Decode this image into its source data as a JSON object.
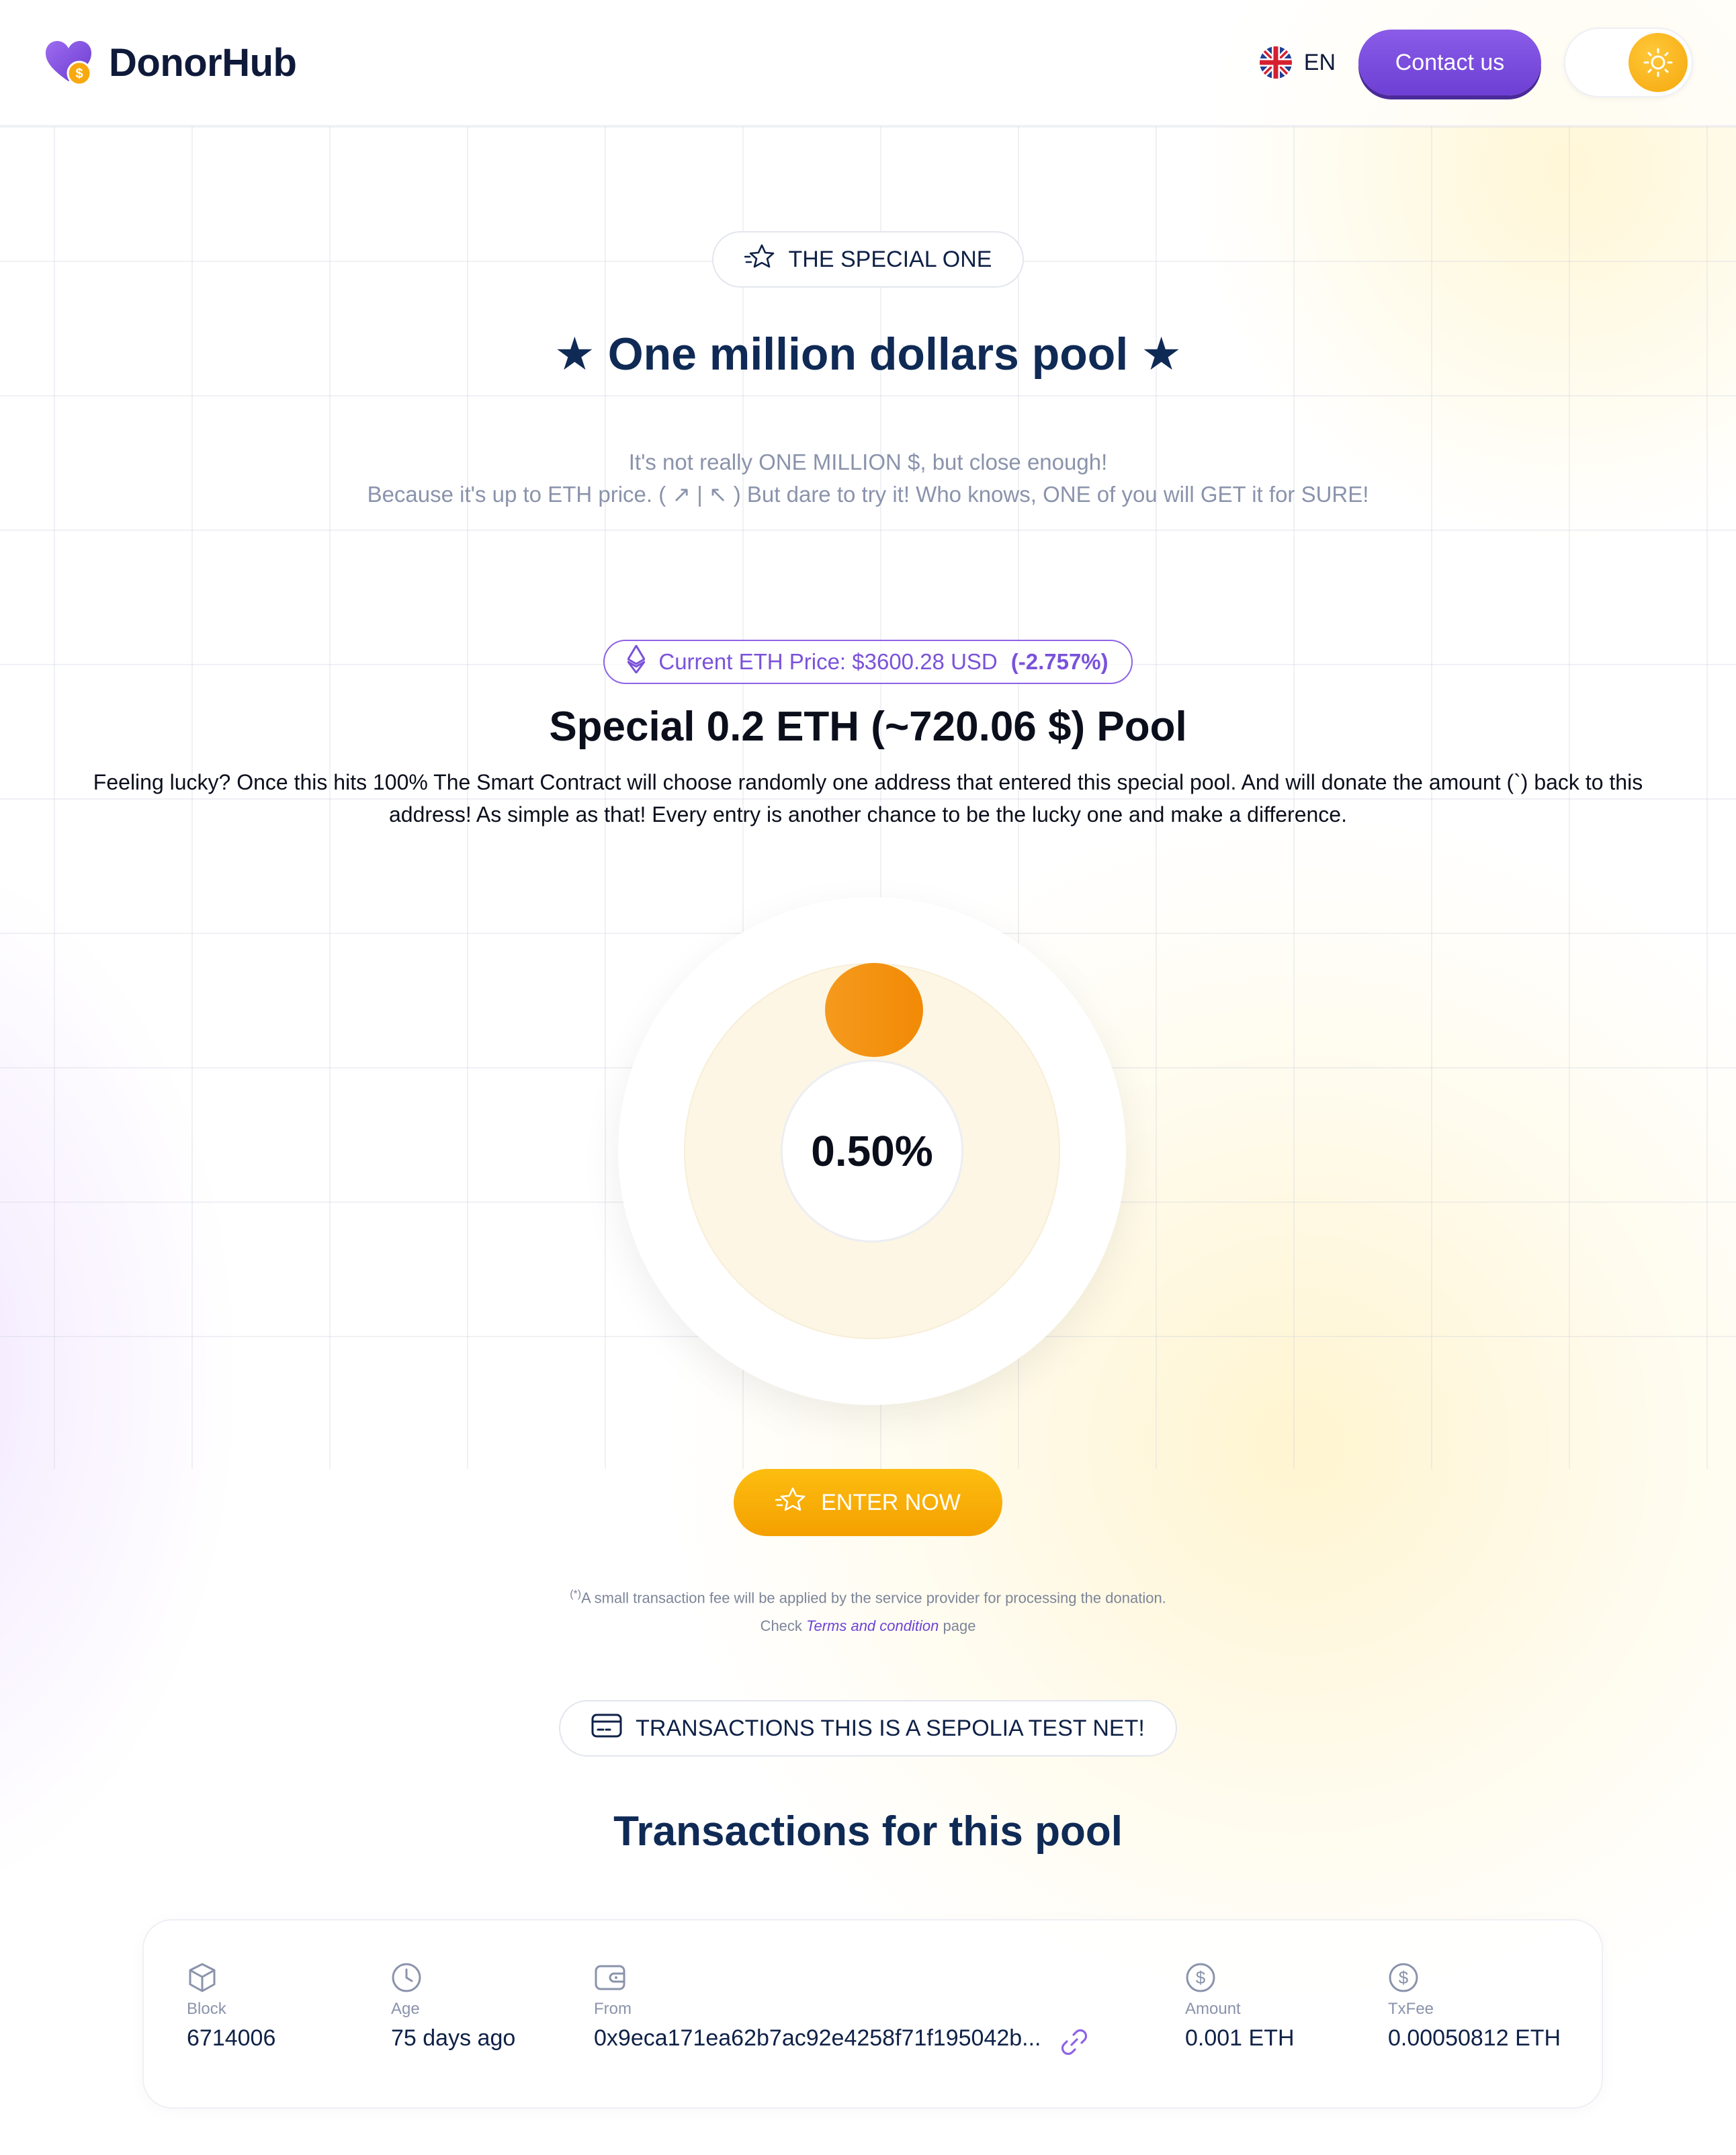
{
  "brand": {
    "name": "DonorHub"
  },
  "header": {
    "language": "EN",
    "contact_label": "Contact us"
  },
  "hero": {
    "badge": "THE SPECIAL ONE",
    "title": "★ One million dollars pool ★",
    "subtitle_line1": "It's not really ONE MILLION $, but close enough!",
    "subtitle_line2": "Because it's up to ETH price. ( ↗ | ↖ ) But dare to try it! Who knows, ONE of you will GET it for SURE!"
  },
  "eth_price": {
    "label": "Current ETH Price: $3600.28 USD",
    "change": "(-2.757%)"
  },
  "pool": {
    "title": "Special 0.2 ETH (~720.06 $) Pool",
    "description": "Feeling lucky? Once this hits 100% The Smart Contract will choose randomly one address that entered this special pool. And will donate the amount (`) back to this address! As simple as that! Every entry is another chance to be the lucky one and make a difference.",
    "progress_label": "0.50%",
    "progress_fraction": 0.005
  },
  "enter": {
    "label": "ENTER NOW"
  },
  "fee_note": {
    "marker": "(*)",
    "text": "A small transaction fee will be applied by the service provider for processing the donation.",
    "check": "Check",
    "terms": "Terms and condition",
    "page": "page"
  },
  "transactions": {
    "badge": "TRANSACTIONS THIS IS A SEPOLIA TEST NET!",
    "title": "Transactions for this pool",
    "columns": {
      "block": "Block",
      "age": "Age",
      "from": "From",
      "amount": "Amount",
      "txfee": "TxFee"
    },
    "rows": [
      {
        "block": "6714006",
        "age": "75 days ago",
        "from": "0x9eca171ea62b7ac92e4258f71f195042b...",
        "amount": "0.001 ETH",
        "txfee": "0.00050812 ETH"
      }
    ]
  },
  "colors": {
    "accent_purple": "#7a52da",
    "accent_orange": "#f4a000",
    "title_navy": "#0f2a55"
  }
}
